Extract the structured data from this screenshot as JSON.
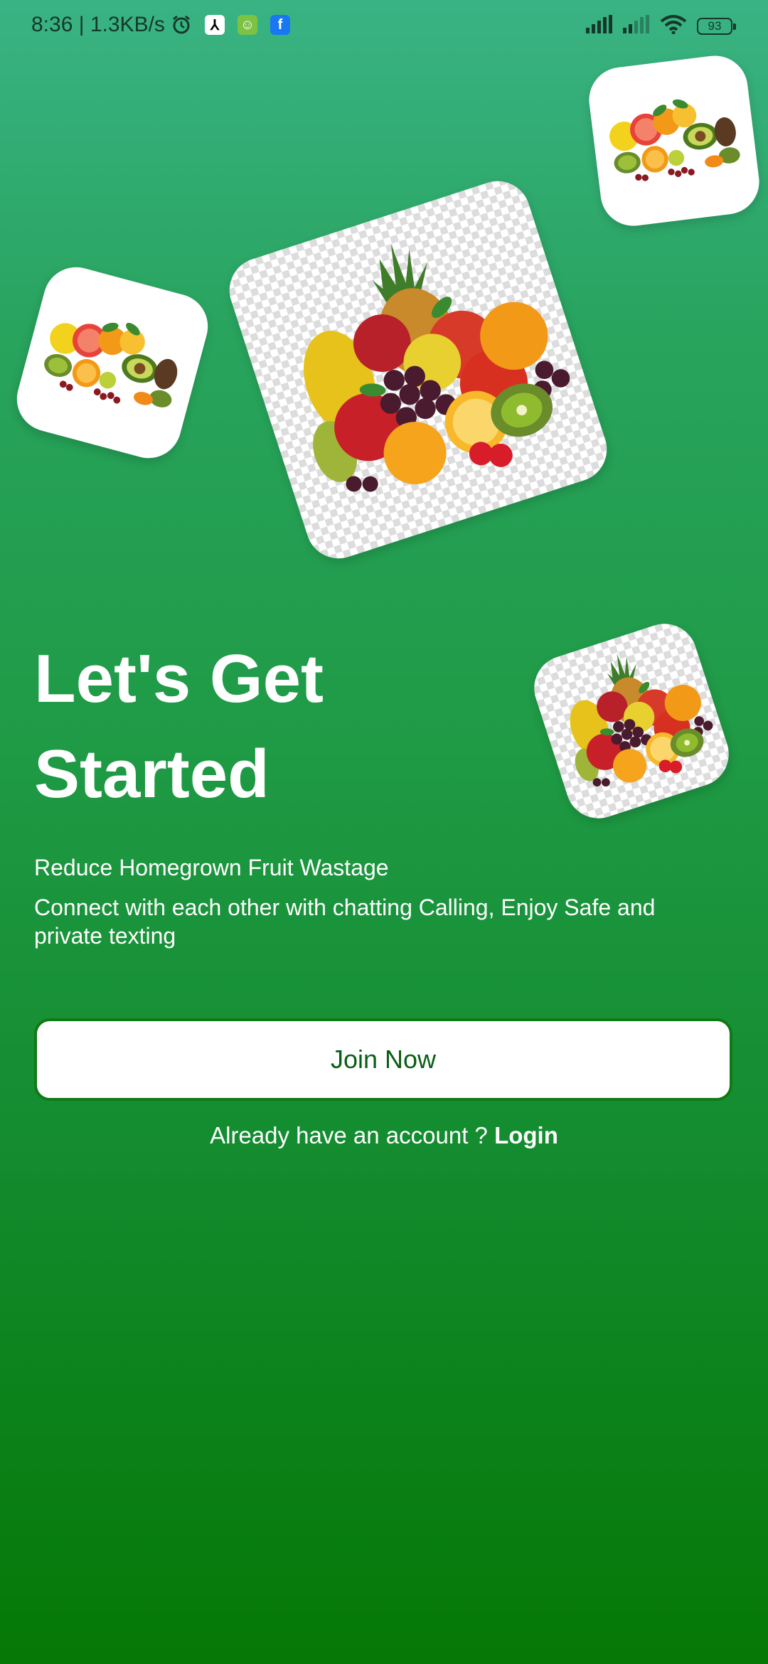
{
  "status_bar": {
    "time_speed": "8:36 | 1.3KB/s",
    "battery": "93",
    "icons": [
      "alarm-icon",
      "app-notification-icon",
      "android-icon",
      "facebook-icon",
      "signal-icon",
      "signal-icon",
      "wifi-icon",
      "battery-icon"
    ]
  },
  "hero_images": [
    {
      "name": "fruit-image-large",
      "icon": "fruit-pile"
    },
    {
      "name": "fruit-image-left",
      "icon": "fruit-pile"
    },
    {
      "name": "fruit-image-top-right",
      "icon": "fruit-pile"
    },
    {
      "name": "fruit-image-mid-right",
      "icon": "fruit-pile"
    }
  ],
  "heading": {
    "line1": "Let's Get",
    "line2": "Started"
  },
  "subtitle": "Reduce Homegrown Fruit Wastage",
  "description": "Connect with each other with chatting Calling, Enjoy Safe and private texting",
  "join_button": "Join Now",
  "login_prompt": {
    "text": "Already have an account ?",
    "link": "Login"
  },
  "colors": {
    "gradient_top": "#3ab384",
    "gradient_bottom": "#057805",
    "button_border": "#0f7a15",
    "button_text": "#0a5e14"
  }
}
